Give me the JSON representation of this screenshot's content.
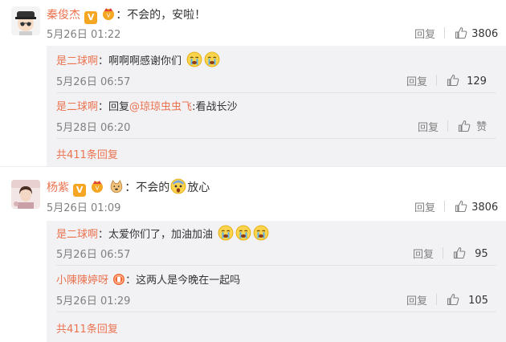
{
  "thread1": {
    "author": "秦俊杰",
    "separator": "：",
    "text": "不会的，安啦！",
    "timestamp": "5月26日 01:22",
    "reply_label": "回复",
    "like_count": "3806",
    "replies": [
      {
        "author": "是二球啊",
        "separator": "：",
        "text": "啊啊啊感谢你们",
        "timestamp": "5月26日 06:57",
        "reply_label": "回复",
        "like_count": "129"
      },
      {
        "author": "是二球啊",
        "separator": "：",
        "prefix": "回复",
        "mention": "@琼琼虫虫飞",
        "text": ":看战长沙",
        "timestamp": "5月28日 06:20",
        "reply_label": "回复",
        "like_label": "赞"
      }
    ],
    "view_all": "共411条回复"
  },
  "thread2": {
    "author": "杨紫",
    "separator": "：",
    "text_before": "不会的",
    "text_after": "放心",
    "timestamp": "5月26日 01:09",
    "reply_label": "回复",
    "like_count": "3806",
    "replies": [
      {
        "author": "是二球啊",
        "separator": "：",
        "text": "太爱你们了，加油加油",
        "timestamp": "5月26日 06:57",
        "reply_label": "回复",
        "like_count": "95"
      },
      {
        "author": "小陳陳婷呀",
        "separator": "：",
        "text": "这两人是今晚在一起吗",
        "timestamp": "5月26日 01:29",
        "reply_label": "回复",
        "like_count": "105"
      }
    ],
    "view_all": "共411条回复"
  },
  "colors": {
    "name": "#eb7350",
    "panel_bg": "#f2f2f5",
    "meta": "#808080"
  },
  "icons": [
    "verified-v-icon",
    "vip-crown-icon",
    "crying-emoji-icon",
    "scared-emoji-icon",
    "doge-emoji-icon",
    "thumbs-up-icon",
    "fan-badge-icon"
  ]
}
